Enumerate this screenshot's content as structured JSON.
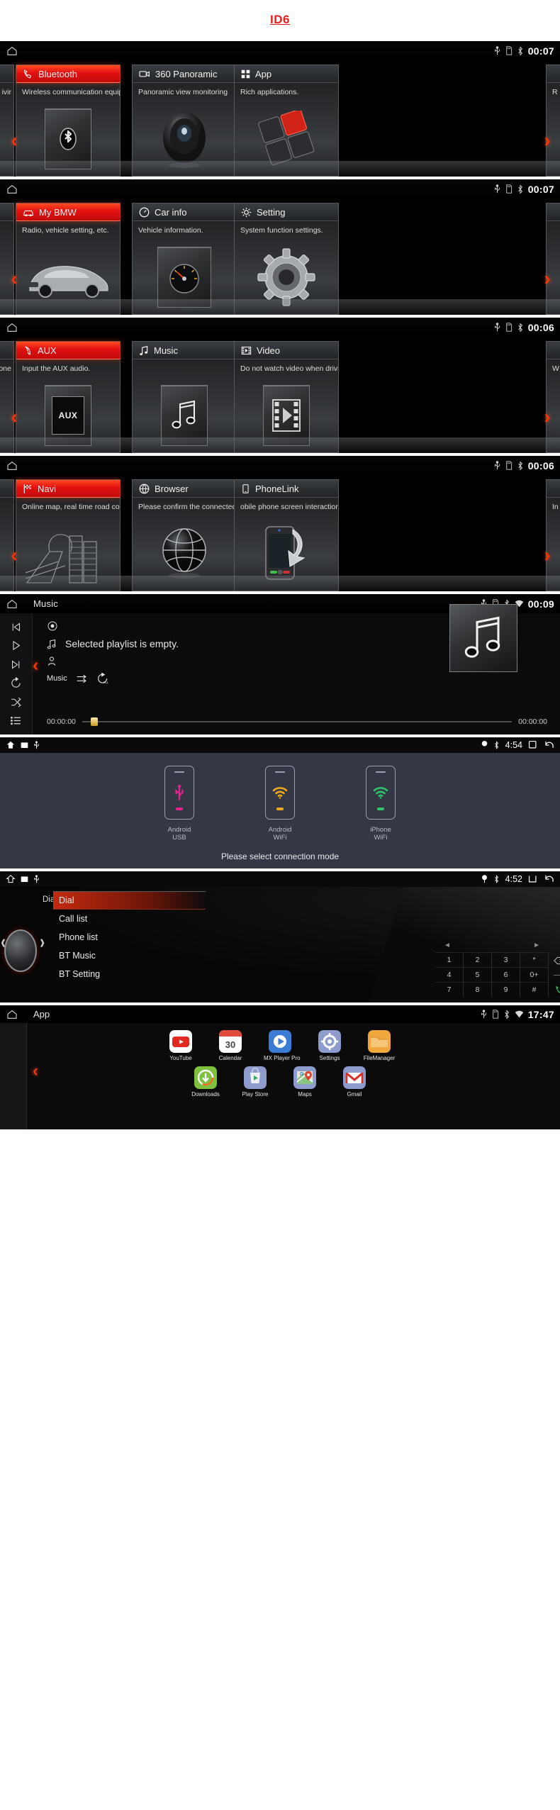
{
  "title": {
    "text": "ID6"
  },
  "screens": [
    {
      "id": "home-1",
      "clock": "00:07",
      "status_icons": [
        "usb-icon",
        "sd-card-icon",
        "bluetooth-icon"
      ],
      "home_icon": "home-icon",
      "left_arrow": "‹",
      "right_arrow": "›",
      "edge_left_text": "ivir",
      "edge_right_text": "R",
      "tiles": [
        {
          "label": "Bluetooth",
          "icon": "phone-handset-icon",
          "desc": "Wireless communication equip",
          "active": true,
          "art": "bluetooth-logo"
        },
        {
          "label": "360 Panoramic",
          "icon": "camera-icon",
          "desc": "Panoramic view monitoring",
          "active": false,
          "art": "camera-lens"
        },
        {
          "label": "App",
          "icon": "grid-icon",
          "desc": "Rich applications.",
          "active": false,
          "art": "app-squares"
        }
      ]
    },
    {
      "id": "home-2",
      "clock": "00:07",
      "status_icons": [
        "usb-icon",
        "sd-card-icon",
        "bluetooth-icon"
      ],
      "home_icon": "home-icon",
      "left_arrow": "‹",
      "right_arrow": "›",
      "edge_left_text": "",
      "edge_right_text": "",
      "tiles": [
        {
          "label": "My BMW",
          "icon": "car-icon",
          "desc": "Radio, vehicle setting, etc.",
          "active": true,
          "art": "bmw-sedan"
        },
        {
          "label": "Car info",
          "icon": "gauge-icon",
          "desc": "Vehicle information.",
          "active": false,
          "art": "speedometer"
        },
        {
          "label": "Setting",
          "icon": "gear-icon",
          "desc": "System function settings.",
          "active": false,
          "art": "big-gear"
        }
      ]
    },
    {
      "id": "home-3",
      "clock": "00:06",
      "status_icons": [
        "usb-icon",
        "sd-card-icon",
        "bluetooth-icon"
      ],
      "home_icon": "home-icon",
      "left_arrow": "‹",
      "right_arrow": "›",
      "edge_left_text": "one",
      "edge_right_text": "W",
      "tiles": [
        {
          "label": "AUX",
          "icon": "aux-plug-icon",
          "desc": "Input the AUX audio.",
          "active": true,
          "art": "aux-box"
        },
        {
          "label": "Music",
          "icon": "music-note-icon",
          "desc": "",
          "active": false,
          "art": "music-note-art"
        },
        {
          "label": "Video",
          "icon": "film-icon",
          "desc": "Do not watch video when drivi",
          "active": false,
          "art": "film-strip"
        }
      ]
    },
    {
      "id": "home-4",
      "clock": "00:06",
      "status_icons": [
        "usb-icon",
        "sd-card-icon",
        "bluetooth-icon"
      ],
      "home_icon": "home-icon",
      "left_arrow": "‹",
      "right_arrow": "›",
      "edge_left_text": "",
      "edge_right_text": "In",
      "tiles": [
        {
          "label": "Navi",
          "icon": "checkered-flag-icon",
          "desc": "Online map, real time road con",
          "active": true,
          "art": "map-city"
        },
        {
          "label": "Browser",
          "icon": "globe-icon",
          "desc": "Please confirm the connected",
          "active": false,
          "art": "globe-art"
        },
        {
          "label": "PhoneLink",
          "icon": "phone-icon",
          "desc": "obile phone screen interaction",
          "active": false,
          "art": "phone-hand"
        }
      ]
    }
  ],
  "music_player": {
    "title": "Music",
    "clock": "00:09",
    "status_icons": [
      "usb-icon",
      "sd-card-icon",
      "bluetooth-icon",
      "wifi-icon"
    ],
    "home_icon": "home-icon",
    "side_buttons": [
      "prev-track-icon",
      "play-icon",
      "next-track-icon",
      "replay-icon",
      "shuffle-icon",
      "playlist-icon"
    ],
    "track_title": "Selected playlist is empty.",
    "artist": "",
    "source_label": "Music",
    "mode_icons": [
      "shuffle-arrows-icon",
      "repeat-all-icon"
    ],
    "time_elapsed": "00:00:00",
    "time_total": "00:00:00",
    "back_arrow": "‹"
  },
  "connection": {
    "clock": "4:54",
    "left_icons": [
      "home-icon",
      "gallery-icon",
      "usb-icon"
    ],
    "right_icons": [
      "location-icon",
      "bluetooth-icon"
    ],
    "trailing_icons": [
      "recents-icon",
      "back-icon"
    ],
    "modes": [
      {
        "label": "Android USB",
        "icon": "usb-icon",
        "color": "#e8238f"
      },
      {
        "label": "Android WiFi",
        "icon": "wifi-icon",
        "color": "#f0a81e"
      },
      {
        "label": "iPhone WiFi",
        "icon": "wifi-icon",
        "color": "#2fc46a"
      }
    ],
    "hint": "Please select connection mode"
  },
  "dial": {
    "clock": "4:52",
    "left_icons": [
      "home-icon",
      "gallery-icon",
      "usb-icon"
    ],
    "right_icons": [
      "location-icon",
      "bluetooth-icon"
    ],
    "trailing_icons": [
      "recents-icon",
      "back-icon"
    ],
    "menu": [
      "Dial",
      "Call list",
      "Phone list",
      "BT Music",
      "BT Setting"
    ],
    "selected_index": 0,
    "panel_title": "Dial",
    "keypad_rows": [
      [
        "1",
        "2",
        "3",
        "*"
      ],
      [
        "4",
        "5",
        "6",
        "0+"
      ],
      [
        "7",
        "8",
        "9",
        "#"
      ]
    ],
    "keypad_side": [
      "backspace-icon",
      "divider",
      "call-icon"
    ],
    "nav_left": "◄",
    "nav_right": "►"
  },
  "app_screen": {
    "title": "App",
    "clock": "17:47",
    "status_icons": [
      "usb-icon",
      "sd-card-icon",
      "bluetooth-icon",
      "wifi-icon"
    ],
    "home_icon": "home-icon",
    "back_arrow": "‹",
    "rows": [
      [
        {
          "label": "YouTube",
          "icon": "youtube-icon",
          "bg": "#c4302b"
        },
        {
          "label": "Calendar",
          "icon": "calendar-icon",
          "bg": "#ffffff",
          "day": "30"
        },
        {
          "label": "MX Player Pro",
          "icon": "mxplayer-icon",
          "bg": "#3b7bd4"
        },
        {
          "label": "Settings",
          "icon": "settings-gear-icon",
          "bg": "#7f8fa6"
        },
        {
          "label": "FileManager",
          "icon": "file-manager-icon",
          "bg": "#f0a83c"
        }
      ],
      [
        {
          "label": "Downloads",
          "icon": "downloads-icon",
          "bg": "#7ec13d"
        },
        {
          "label": "Play Store",
          "icon": "play-store-icon",
          "bg": "#8d9ccd"
        },
        {
          "label": "Maps",
          "icon": "maps-icon",
          "bg": "#8d9ccd"
        },
        {
          "label": "Gmail",
          "icon": "gmail-icon",
          "bg": "#8d9ccd"
        }
      ]
    ]
  }
}
